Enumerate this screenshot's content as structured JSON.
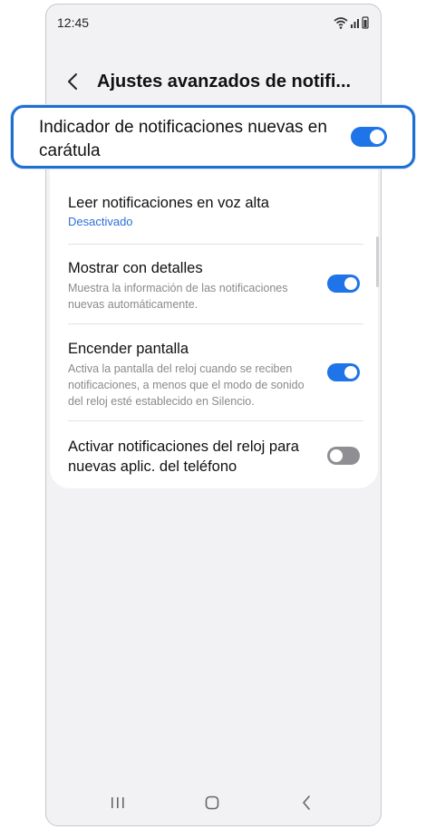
{
  "status_bar": {
    "time": "12:45"
  },
  "header": {
    "title": "Ajustes avanzados de notifi..."
  },
  "highlighted_setting": {
    "title": "Indicador de notificaciones nuevas en carátula",
    "enabled": true
  },
  "settings": [
    {
      "title": "Leer notificaciones en voz alta",
      "value": "Desactivado"
    },
    {
      "title": "Mostrar con detalles",
      "description": "Muestra la información de las notificaciones nuevas automáticamente.",
      "enabled": true
    },
    {
      "title": "Encender pantalla",
      "description": "Activa la pantalla del reloj cuando se reciben notificaciones, a menos que el modo de sonido del reloj esté establecido en Silencio.",
      "enabled": true
    },
    {
      "title": "Activar notificaciones del reloj para nuevas aplic. del teléfono",
      "enabled": false
    }
  ],
  "icons": {
    "back": "chevron-left-icon",
    "wifi": "wifi-icon",
    "signal": "signal-icon",
    "battery": "battery-icon",
    "recents": "recents-icon",
    "home": "home-icon",
    "nav_back": "nav-back-icon"
  },
  "colors": {
    "accent": "#1f74e8",
    "highlight_border": "#1e6fd0",
    "toggle_off": "#8f8f93",
    "link_blue": "#2d6fd8"
  }
}
